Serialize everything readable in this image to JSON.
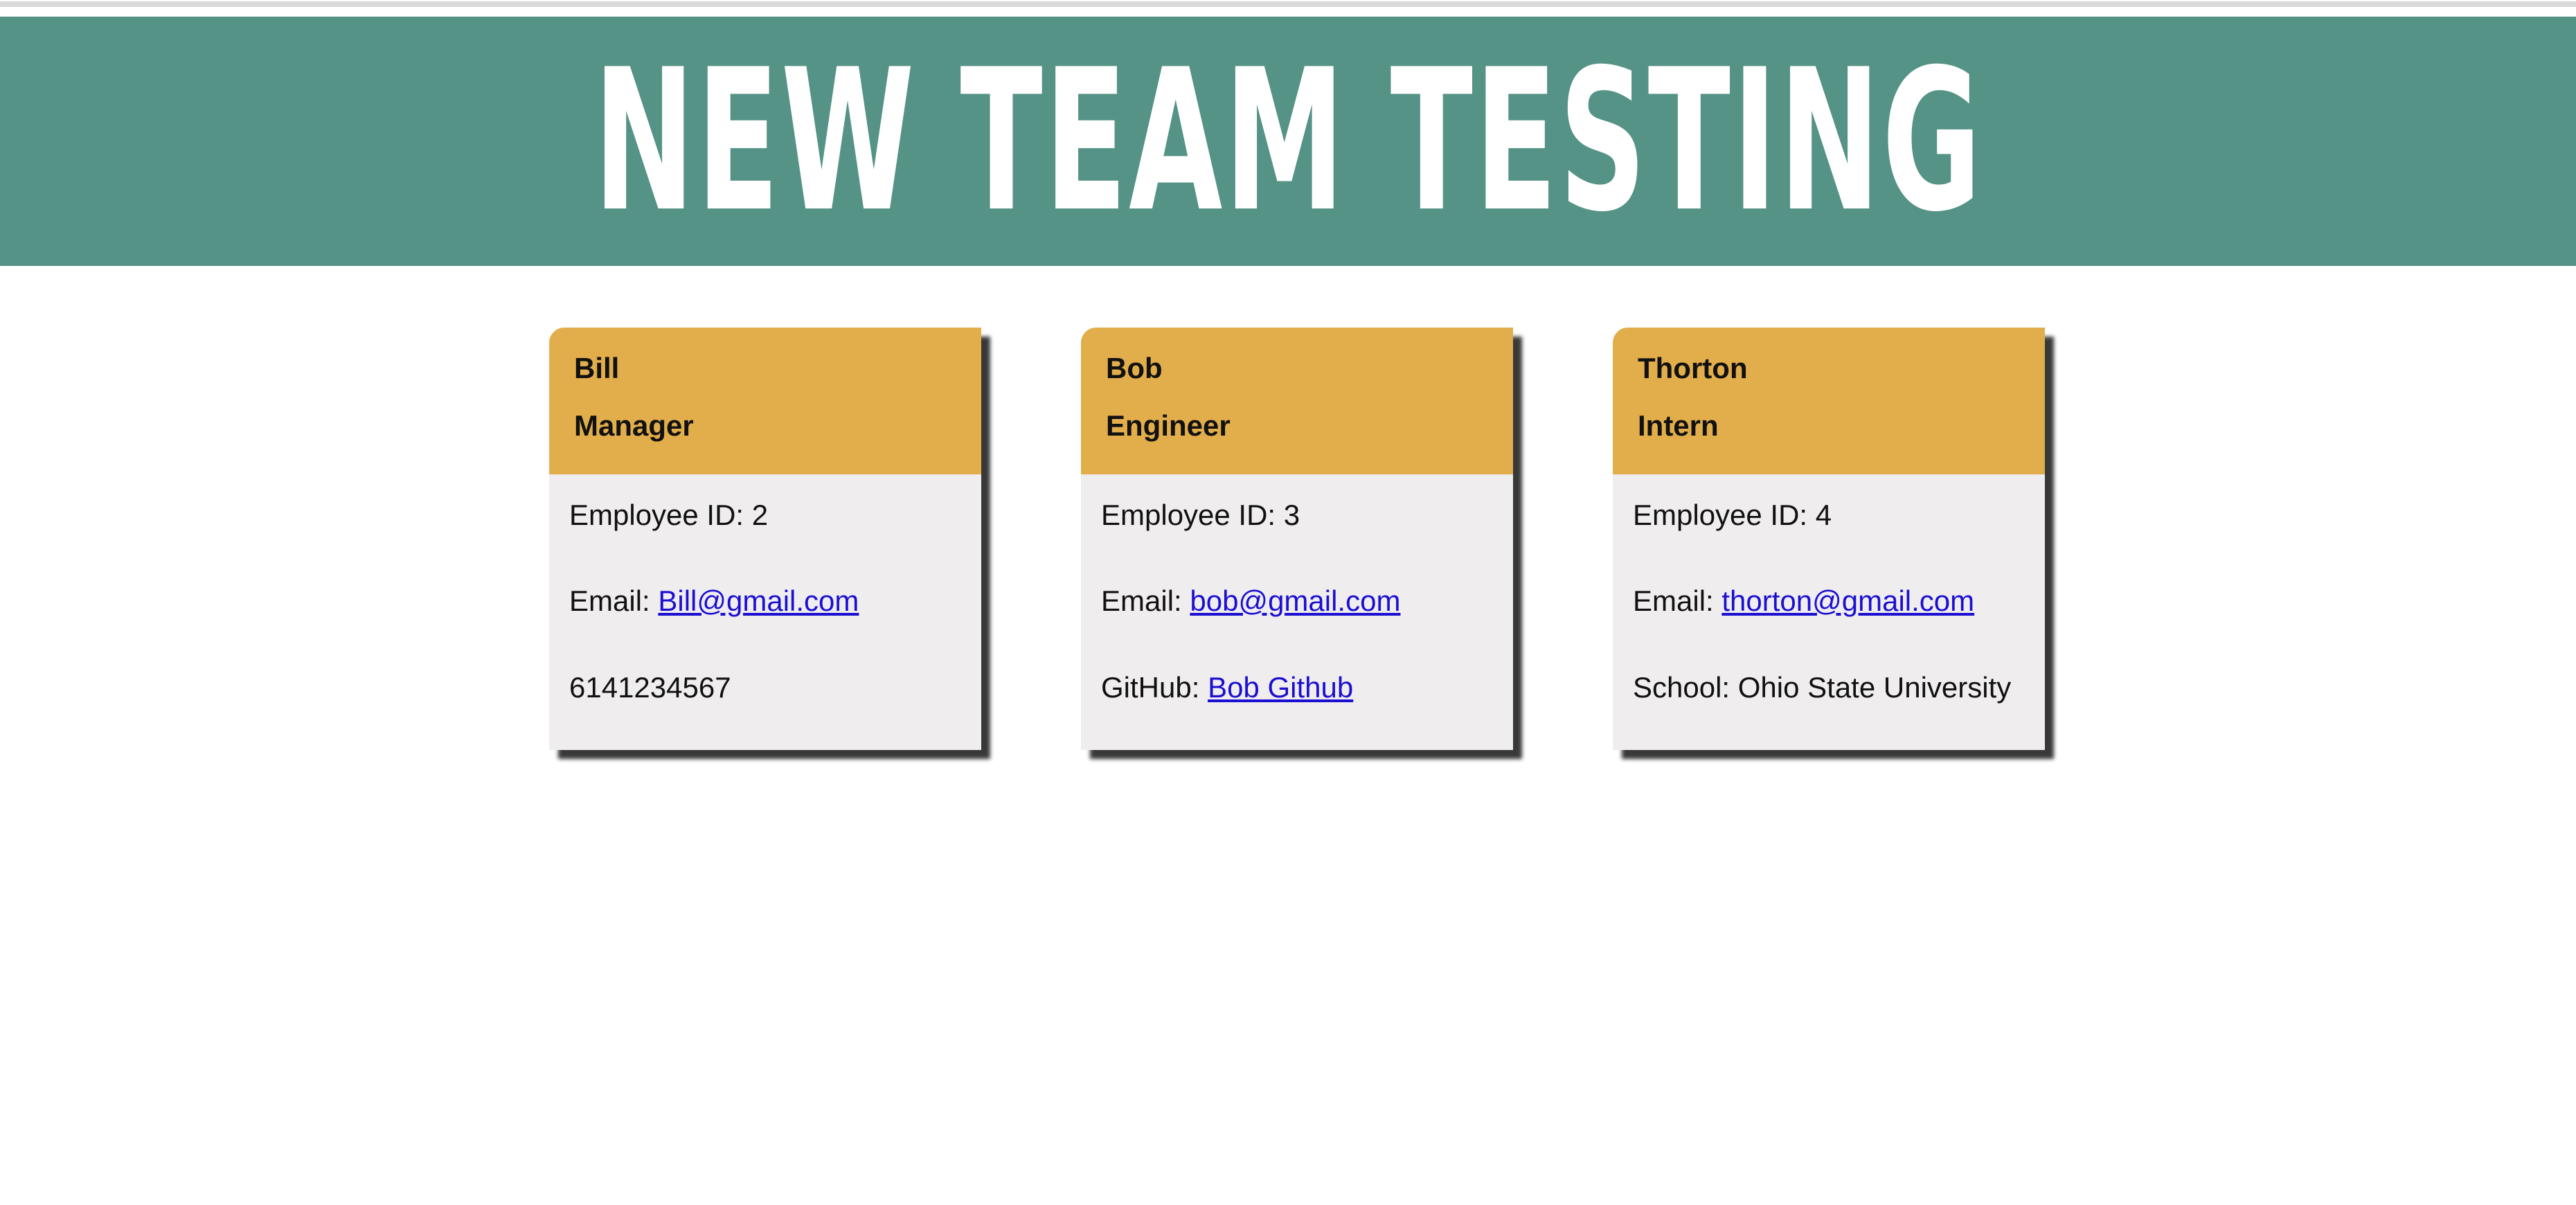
{
  "header": {
    "title": "NEW TEAM TESTING"
  },
  "cards": [
    {
      "name": "Bill",
      "role": "Manager",
      "employee_id_text": "Employee ID: 2",
      "email_label": "Email: ",
      "email_value": "Bill@gmail.com",
      "extra_text": "6141234567"
    },
    {
      "name": "Bob",
      "role": "Engineer",
      "employee_id_text": "Employee ID: 3",
      "email_label": "Email: ",
      "email_value": "bob@gmail.com",
      "github_label": "GitHub: ",
      "github_value": "Bob Github"
    },
    {
      "name": "Thorton",
      "role": "Intern",
      "employee_id_text": "Employee ID: 4",
      "email_label": "Email: ",
      "email_value": "thorton@gmail.com",
      "school_text": "School: Ohio State University"
    }
  ],
  "colors": {
    "hero_bg": "#559386",
    "card_header_bg": "#e2ad4b",
    "card_body_bg": "#efedee",
    "link": "#1b0fd1"
  }
}
